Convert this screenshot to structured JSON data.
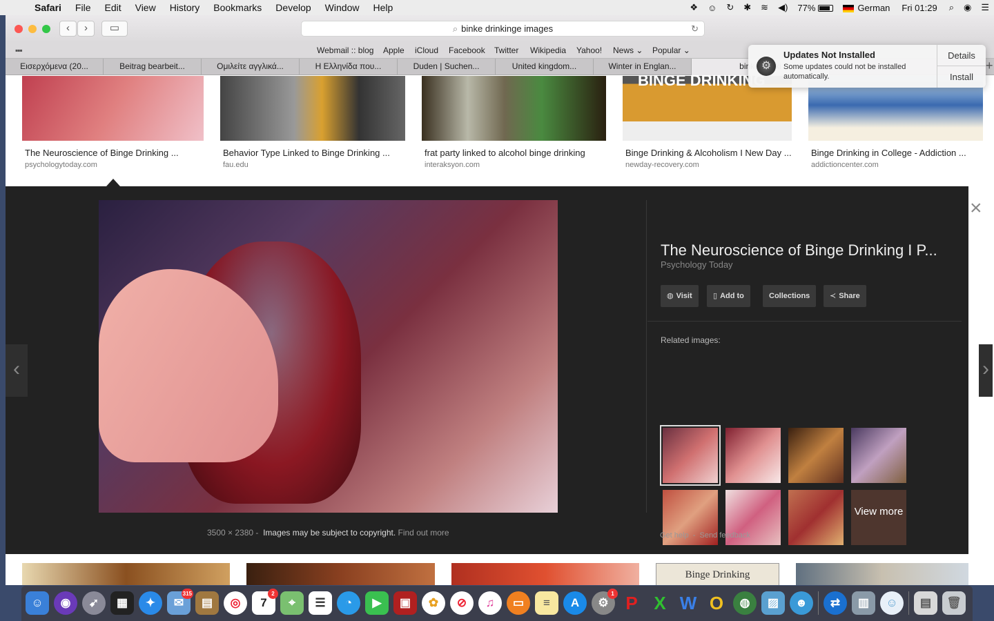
{
  "menubar": {
    "app": "Safari",
    "items": [
      "File",
      "Edit",
      "View",
      "History",
      "Bookmarks",
      "Develop",
      "Window",
      "Help"
    ],
    "battery": "77%",
    "language": "German",
    "clock": "Fri 01:29"
  },
  "toolbar": {
    "url": "binke drinkinge images"
  },
  "favorites": [
    "Webmail :: blog",
    "Apple",
    "iCloud",
    "Facebook",
    "Twitter",
    "Wikipedia",
    "Yahoo!",
    "News ⌄",
    "Popular ⌄"
  ],
  "tabs": [
    "Εισερχόμενα (20...",
    "Beitrag bearbeit...",
    "Ομιλείτε αγγλικά...",
    "Η Ελληνίδα που...",
    "Duden | Suchen...",
    "United kingdom...",
    "Winter in Englan...",
    "binke drinki"
  ],
  "notification": {
    "title": "Updates Not Installed",
    "message": "Some updates could not be installed automatically.",
    "details": "Details",
    "install": "Install"
  },
  "results": [
    {
      "title": "The Neuroscience of Binge Drinking ...",
      "source": "psychologytoday.com"
    },
    {
      "title": "Behavior Type Linked to Binge Drinking ...",
      "source": "fau.edu"
    },
    {
      "title": "frat party linked to alcohol binge drinking",
      "source": "interaksyon.com"
    },
    {
      "title": "Binge Drinking & Alcoholism I New Day ...",
      "source": "newday-recovery.com"
    },
    {
      "title": "Binge Drinking in College - Addiction ...",
      "source": "addictioncenter.com"
    }
  ],
  "thumb_text": "BINGE DRINKING",
  "viewer": {
    "title": "The Neuroscience of Binge Drinking I P...",
    "subtitle": "Psychology Today",
    "visit": "Visit",
    "add_to": "Add to",
    "collections": "Collections",
    "share": "Share",
    "related_label": "Related images:",
    "view_more": "View more",
    "dimensions": "3500 × 2380",
    "copyright": "Images may be subject to copyright.",
    "find_out": "Find out more",
    "get_help": "Get help",
    "send_feedback": "Send feedback"
  },
  "bottom_thumb_text": "Binge Drinking",
  "dock_badges": {
    "mail": "315",
    "calendar": "2",
    "prefs": "1"
  },
  "calendar_day": "7"
}
